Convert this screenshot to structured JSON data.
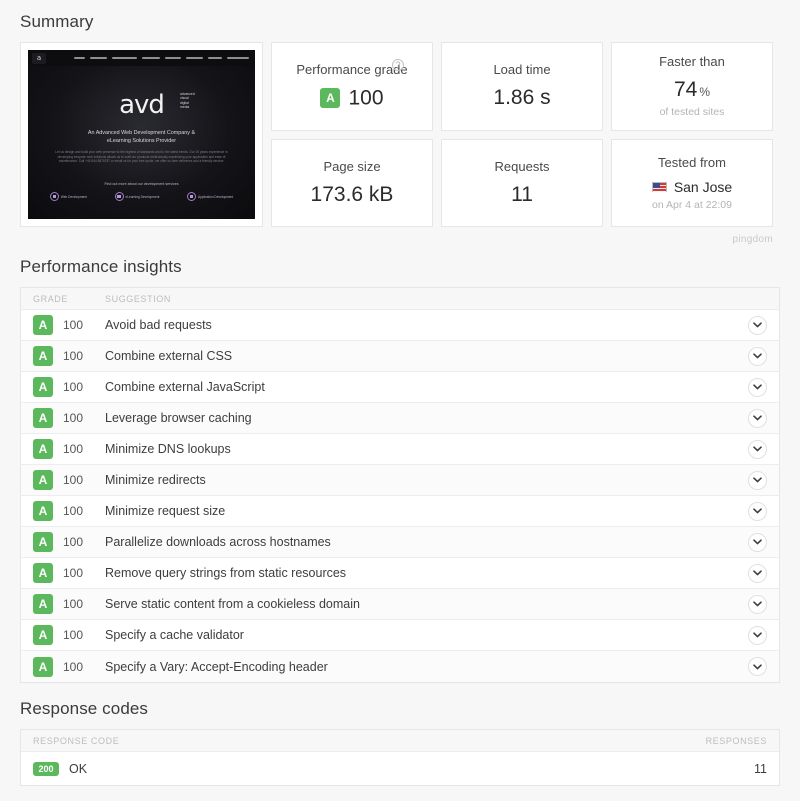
{
  "summary": {
    "title": "Summary",
    "thumbnail": {
      "brand": "avd",
      "brand_sub": "advanced\nvisual\ndigital\nmedia",
      "tagline": "An Advanced Web Development Company &\neLearning Solutions Provider",
      "paragraph": "Let us design and build your web presence to the highest of standards and to the latest trends. Our 20 years experience in developing bespoke web solutions allows us to craft our products meticulously maximizing your application and ease of maintenance. Call +44 844 8878787 or email us for your free quote, we offer on-time deliveries and a friendly service.",
      "cta": "Find out more about our development services",
      "nav_items": [
        "home",
        "web design",
        "elearning solutions",
        "applications",
        "game design",
        "outsourcing",
        "consulting",
        "technical training"
      ],
      "services": [
        "Web Development",
        "eLearning Development",
        "Application Development"
      ]
    },
    "cards": [
      {
        "name": "performance-grade",
        "label": "Performance grade",
        "grade": "A",
        "value": "100",
        "has_help": true
      },
      {
        "name": "load-time",
        "label": "Load time",
        "value": "1.86 s"
      },
      {
        "name": "faster-than",
        "label": "Faster than",
        "value": "74",
        "unit": "%",
        "sub": "of tested sites"
      },
      {
        "name": "page-size",
        "label": "Page size",
        "value": "173.6 kB"
      },
      {
        "name": "requests",
        "label": "Requests",
        "value": "11"
      },
      {
        "name": "tested-from",
        "label": "Tested from",
        "city": "San Jose",
        "flag": "us-flag-icon",
        "sub": "on Apr 4 at 22:09"
      }
    ],
    "watermark": "pingdom"
  },
  "insights": {
    "title": "Performance insights",
    "columns": {
      "grade": "GRADE",
      "suggestion": "SUGGESTION"
    },
    "rows": [
      {
        "grade": "A",
        "score": "100",
        "suggestion": "Avoid bad requests"
      },
      {
        "grade": "A",
        "score": "100",
        "suggestion": "Combine external CSS"
      },
      {
        "grade": "A",
        "score": "100",
        "suggestion": "Combine external JavaScript"
      },
      {
        "grade": "A",
        "score": "100",
        "suggestion": "Leverage browser caching"
      },
      {
        "grade": "A",
        "score": "100",
        "suggestion": "Minimize DNS lookups"
      },
      {
        "grade": "A",
        "score": "100",
        "suggestion": "Minimize redirects"
      },
      {
        "grade": "A",
        "score": "100",
        "suggestion": "Minimize request size"
      },
      {
        "grade": "A",
        "score": "100",
        "suggestion": "Parallelize downloads across hostnames"
      },
      {
        "grade": "A",
        "score": "100",
        "suggestion": "Remove query strings from static resources"
      },
      {
        "grade": "A",
        "score": "100",
        "suggestion": "Serve static content from a cookieless domain"
      },
      {
        "grade": "A",
        "score": "100",
        "suggestion": "Specify a cache validator"
      },
      {
        "grade": "A",
        "score": "100",
        "suggestion": "Specify a Vary: Accept-Encoding header"
      }
    ]
  },
  "response_codes": {
    "title": "Response codes",
    "columns": {
      "code": "RESPONSE CODE",
      "responses": "RESPONSES"
    },
    "rows": [
      {
        "code": "200",
        "label": "OK",
        "count": "11"
      }
    ]
  },
  "colors": {
    "grade_green": "#5cb85c",
    "page_bg": "#f7f7f7",
    "card_bg": "#ffffff"
  }
}
